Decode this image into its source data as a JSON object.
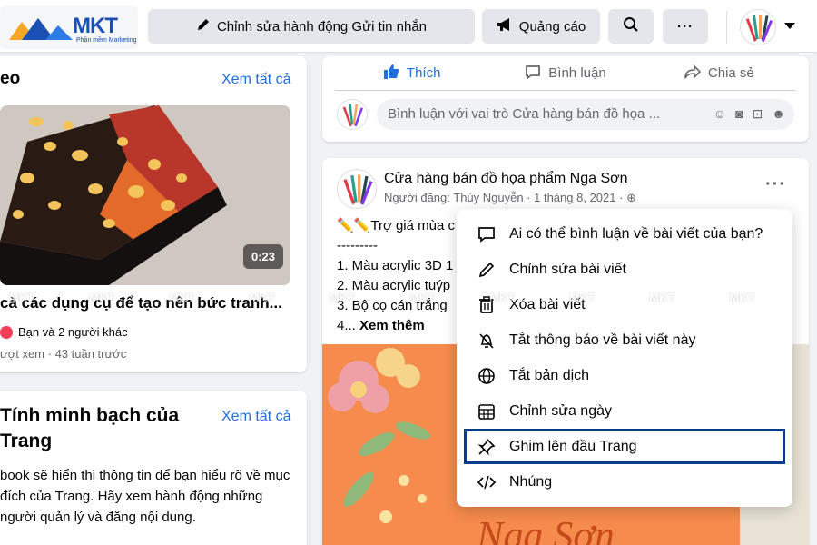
{
  "topbar": {
    "logo": {
      "brand": "MKT",
      "tagline": "Phần mềm Marketing"
    },
    "edit_action_label": "Chỉnh sửa hành động Gửi tin nhắn",
    "ads_label": "Quảng cáo"
  },
  "left": {
    "video_card": {
      "title": "eo",
      "see_all": "Xem tất cả",
      "duration": "0:23",
      "video_title": "cà các dụng cụ để tạo nên bức tranh...",
      "reactions": "Bạn và 2 người khác",
      "meta": "ượt xem · 43 tuần trước"
    },
    "transparency_card": {
      "title": "Tính minh bạch của Trang",
      "see_all": "Xem tất cả",
      "description": "book sẽ hiển thị thông tin để bạn hiểu rõ về mục đích của Trang. Hãy xem hành động những người quản lý và đăng nội dung."
    }
  },
  "post_actions": {
    "like": "Thích",
    "comment": "Bình luận",
    "share": "Chia sẻ",
    "comment_placeholder": "Bình luận với vai trò Cửa hàng bán đồ họa ..."
  },
  "post": {
    "page_name": "Cửa hàng bán đồ họa phẩm Nga Sơn",
    "meta": "Người đăng: Thúy Nguyễn · 1 tháng 8, 2021 ·",
    "body_lines": [
      "✏️✏️Trợ giá mùa c",
      "---------",
      "1. Màu acrylic 3D 1",
      "2. Màu acrylic tuýp",
      "3. Bộ cọ cán trắng"
    ],
    "see_more_prefix": "4...",
    "see_more": "Xem thêm",
    "image_caption": "Nga Sơn"
  },
  "menu": {
    "items": [
      {
        "icon": "comment-icon",
        "label": "Ai có thể bình luận về bài viết của bạn?"
      },
      {
        "icon": "pencil-icon",
        "label": "Chỉnh sửa bài viết"
      },
      {
        "icon": "trash-icon",
        "label": "Xóa bài viết"
      },
      {
        "icon": "bell-off-icon",
        "label": "Tắt thông báo về bài viết này"
      },
      {
        "icon": "globe-icon",
        "label": "Tắt bản dịch"
      },
      {
        "icon": "calendar-icon",
        "label": "Chỉnh sửa ngày"
      },
      {
        "icon": "pin-icon",
        "label": "Ghim lên đầu Trang",
        "highlighted": true
      },
      {
        "icon": "code-icon",
        "label": "Nhúng"
      }
    ]
  },
  "watermark": [
    "MKT",
    "MKT",
    "MKT",
    "MKT",
    "MKT",
    "MKT",
    "MKT",
    "MKT",
    "MKT",
    "MKT"
  ],
  "colors": {
    "accent": "#216fdb",
    "highlight_border": "#0e3a8c",
    "brand": "#1a4fb3"
  }
}
